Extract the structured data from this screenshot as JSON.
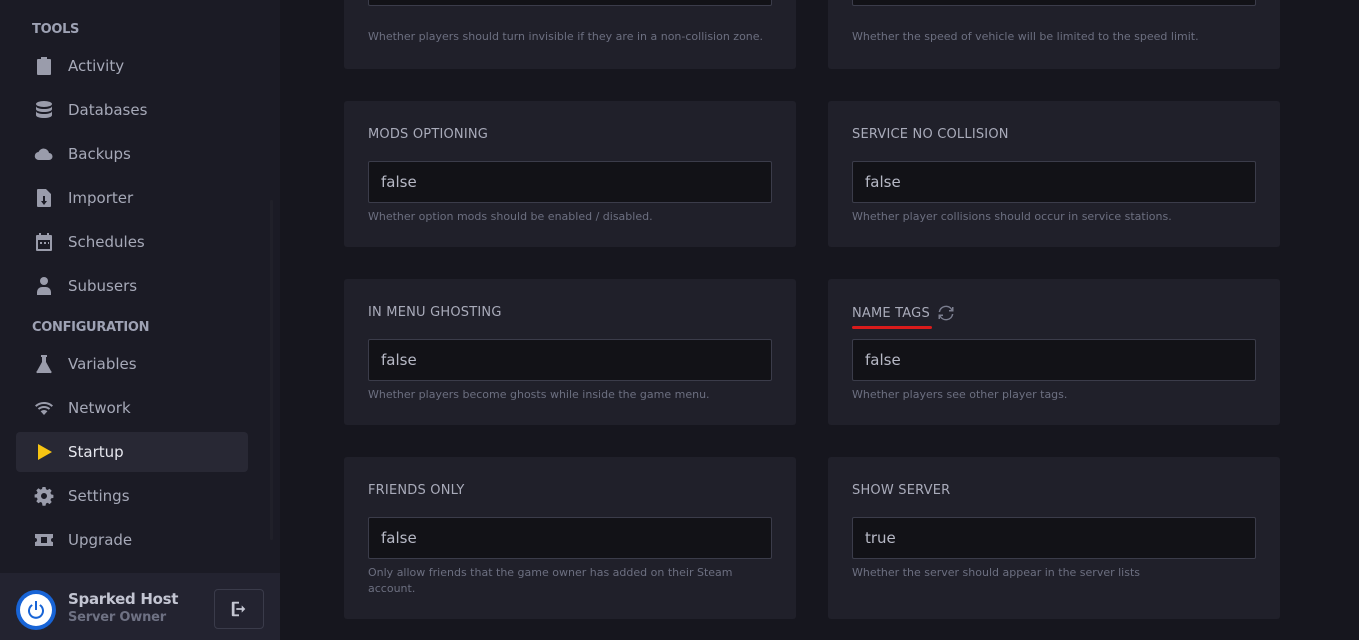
{
  "sidebar": {
    "tools_title": "TOOLS",
    "config_title": "CONFIGURATION",
    "items": [
      {
        "label": "Activity",
        "icon": "clipboard-icon"
      },
      {
        "label": "Databases",
        "icon": "database-icon"
      },
      {
        "label": "Backups",
        "icon": "cloud-icon"
      },
      {
        "label": "Importer",
        "icon": "file-import-icon"
      },
      {
        "label": "Schedules",
        "icon": "calendar-icon"
      },
      {
        "label": "Subusers",
        "icon": "user-icon"
      },
      {
        "label": "Variables",
        "icon": "flask-icon"
      },
      {
        "label": "Network",
        "icon": "wifi-icon"
      },
      {
        "label": "Startup",
        "icon": "play-icon",
        "active": true
      },
      {
        "label": "Settings",
        "icon": "gear-icon"
      },
      {
        "label": "Upgrade",
        "icon": "ticket-icon"
      }
    ],
    "user": {
      "name": "Sparked Host",
      "role": "Server Owner"
    }
  },
  "cards": [
    {
      "label": "",
      "value": "true",
      "help": "Whether players should turn invisible if they are in a non-collision zone."
    },
    {
      "label": "",
      "value": "false",
      "help": "Whether the speed of vehicle will be limited to the speed limit."
    },
    {
      "label": "MODS OPTIONING",
      "value": "false",
      "help": "Whether option mods should be enabled / disabled."
    },
    {
      "label": "SERVICE NO COLLISION",
      "value": "false",
      "help": "Whether player collisions should occur in service stations."
    },
    {
      "label": "IN MENU GHOSTING",
      "value": "false",
      "help": "Whether players become ghosts while inside the game menu."
    },
    {
      "label": "NAME TAGS",
      "value": "false",
      "help": "Whether players see other player tags."
    },
    {
      "label": "FRIENDS ONLY",
      "value": "false",
      "help": "Only allow friends that the game owner has added on their Steam account."
    },
    {
      "label": "SHOW SERVER",
      "value": "true",
      "help": "Whether the server should appear in the server lists"
    }
  ],
  "colors": {
    "accent": "#f7c512",
    "highlight_underline": "#d91b1b",
    "avatar": "#1864d6"
  }
}
